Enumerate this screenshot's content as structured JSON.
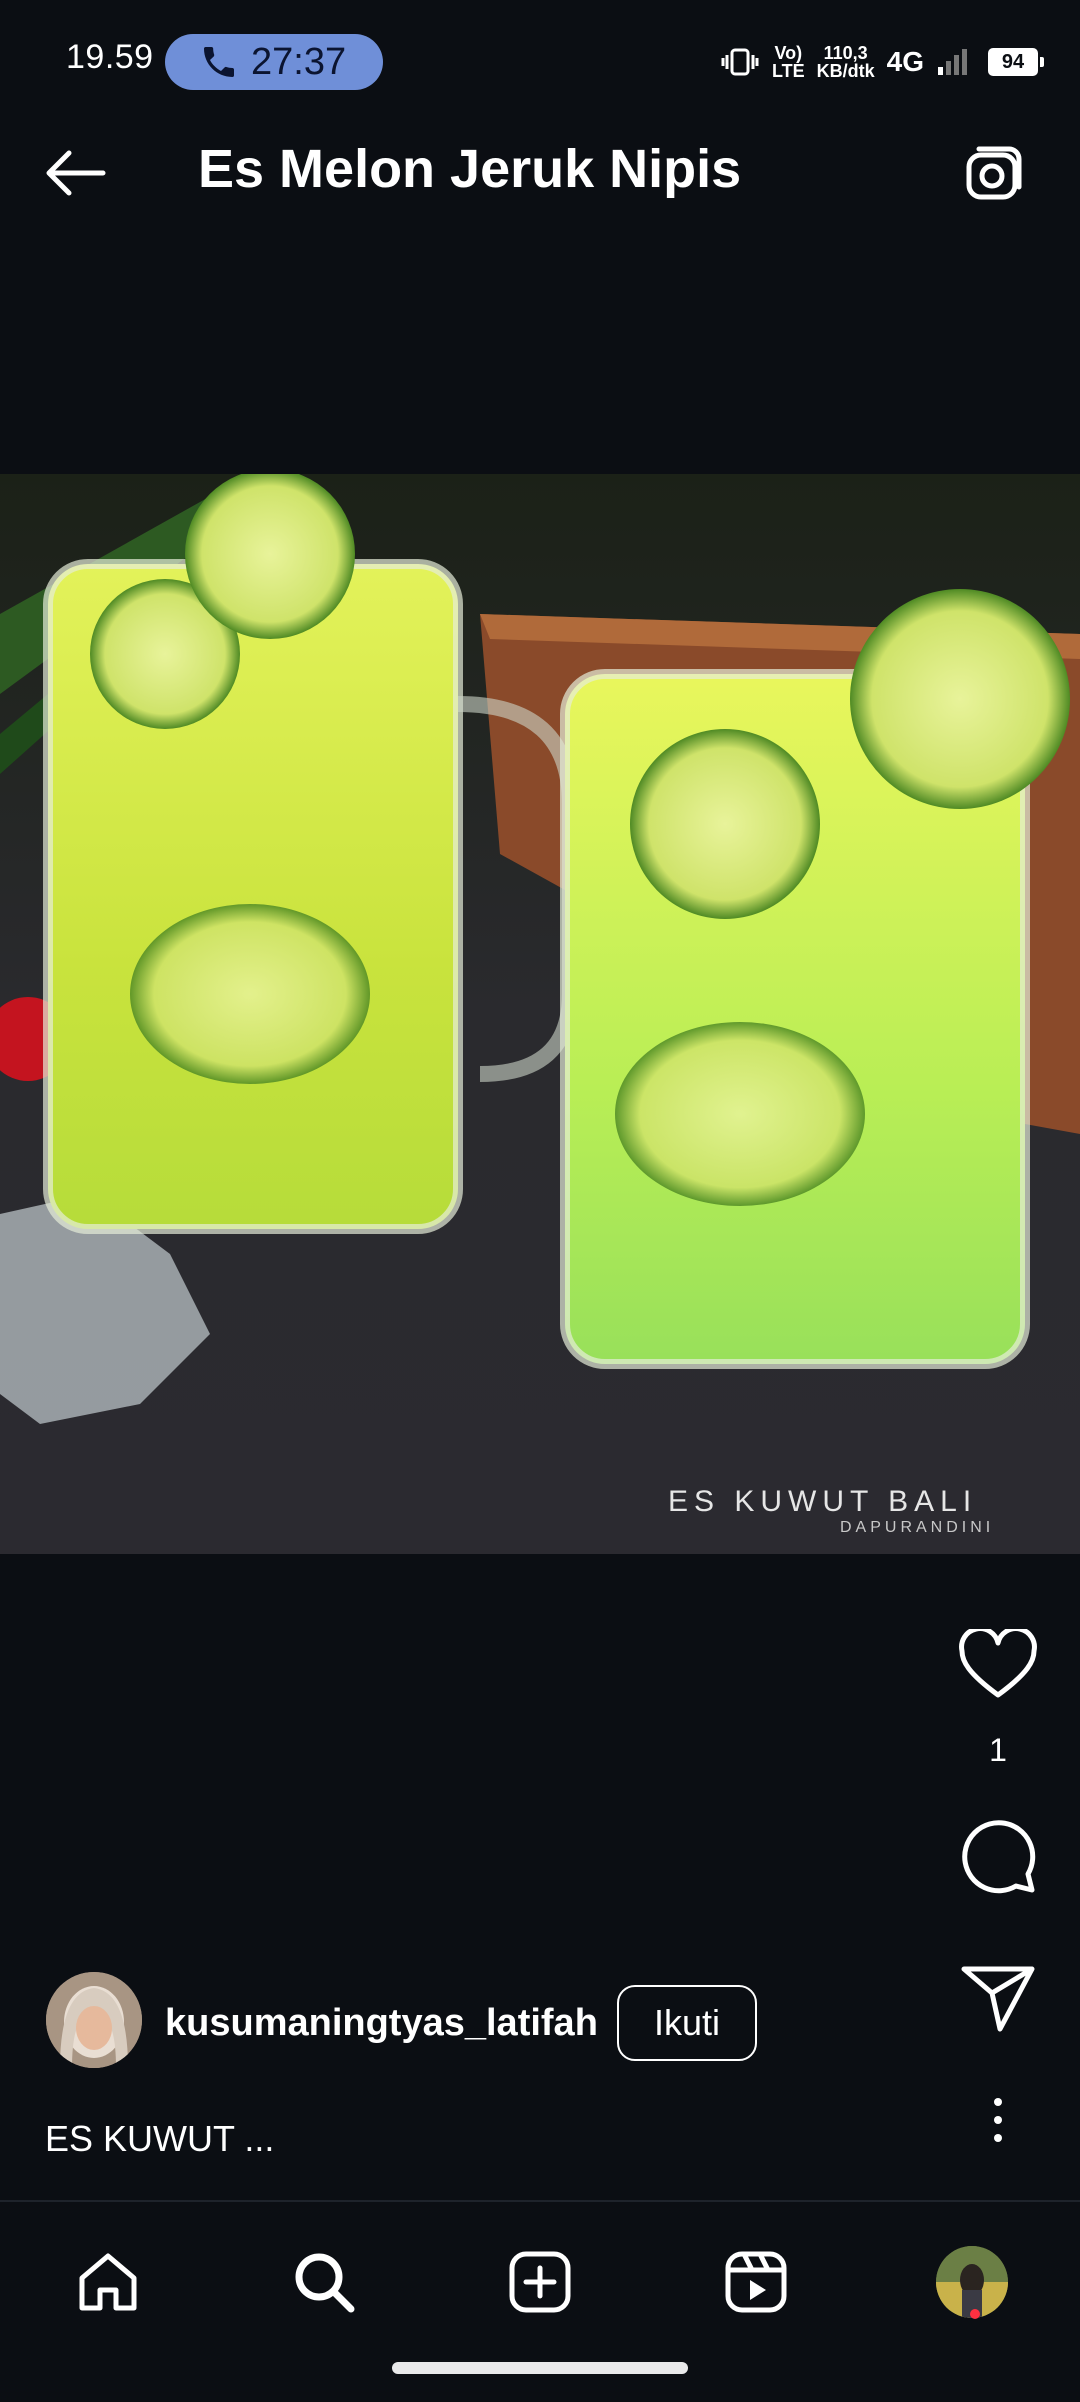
{
  "status_bar": {
    "time": "19.59",
    "call_timer": "27:37",
    "volte": "Vo)",
    "lte": "LTE",
    "speed_value": "110,3",
    "speed_unit": "KB/dtk",
    "network": "4G",
    "battery": "94"
  },
  "header": {
    "title": "Es Melon Jeruk Nipis",
    "back_icon": "arrow-left-icon",
    "camera_icon": "camera-icon"
  },
  "post": {
    "image_watermark": "ES KUWUT BALI",
    "image_watermark_sub": "DAPURANDINI",
    "like_count": "1",
    "author": "kusumaningtyas_latifah",
    "follow_label": "Ikuti",
    "caption": "ES KUWUT ..."
  },
  "nav": {
    "items": [
      "home-icon",
      "search-icon",
      "create-icon",
      "reels-icon",
      "profile-avatar"
    ]
  },
  "colors": {
    "background": "#0b0e13",
    "call_pill": "#6f8fd8",
    "notification_dot": "#ff3040"
  }
}
